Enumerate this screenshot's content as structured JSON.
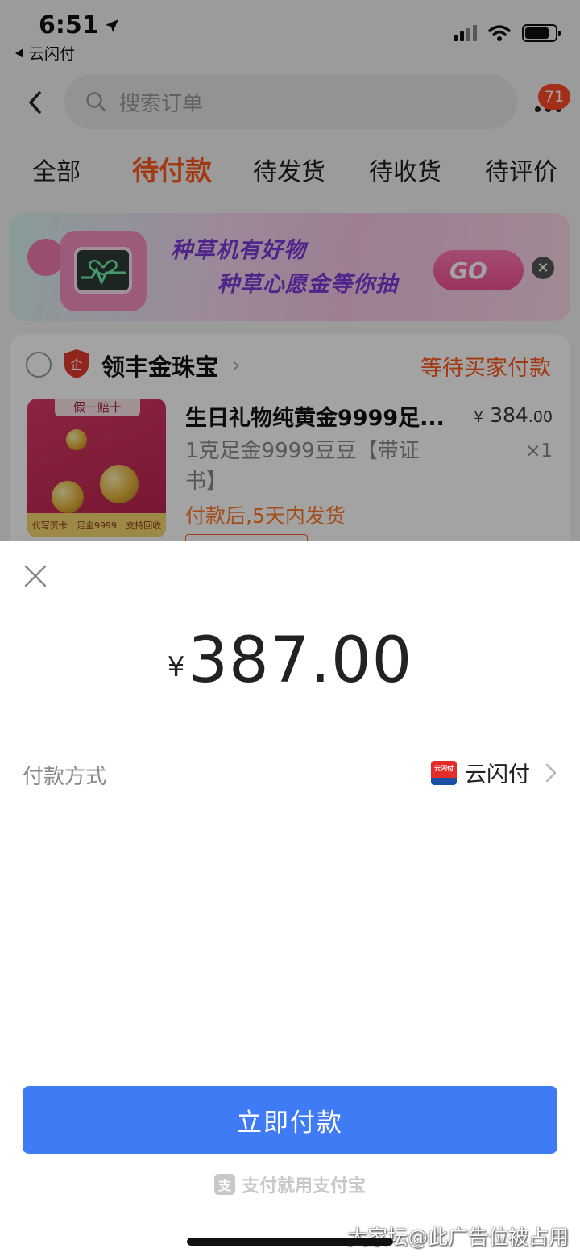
{
  "status_bar": {
    "time": "6:51",
    "back_app": "云闪付"
  },
  "header": {
    "search_placeholder": "搜索订单",
    "message_count": "71"
  },
  "tabs": [
    {
      "label": "全部",
      "active": false
    },
    {
      "label": "待付款",
      "active": true
    },
    {
      "label": "待发货",
      "active": false
    },
    {
      "label": "待收货",
      "active": false
    },
    {
      "label": "待评价",
      "active": false
    }
  ],
  "banner": {
    "line1": "种草机有好物",
    "line2": "种草心愿金等你抽",
    "go_label": "GO"
  },
  "order": {
    "shop_name": "领丰金珠宝",
    "shop_badge": "企",
    "status": "等待买家付款",
    "image_tag_top": "假一赔十",
    "image_tag_bottom": [
      "代写贺卡",
      "足金9999",
      "支持回收"
    ],
    "title": "生日礼物纯黄金9999足...",
    "price_symbol": "¥",
    "price_int": "384",
    "price_dec": ".00",
    "spec": "1克足金9999豆豆【带证书】",
    "quantity": "×1",
    "ship_note": "付款后,5天内发货"
  },
  "payment_sheet": {
    "currency": "¥",
    "amount": "387.00",
    "method_label": "付款方式",
    "method_name": "云闪付",
    "method_logo_text": "云闪付",
    "pay_button": "立即付款",
    "slogan": "支付就用支付宝",
    "slogan_mark": "支"
  },
  "watermark": "大家坛@此广告位被占用",
  "colors": {
    "accent": "#ff5a1f",
    "pay_button": "#3f7bf5",
    "badge": "#ff4a2a"
  }
}
